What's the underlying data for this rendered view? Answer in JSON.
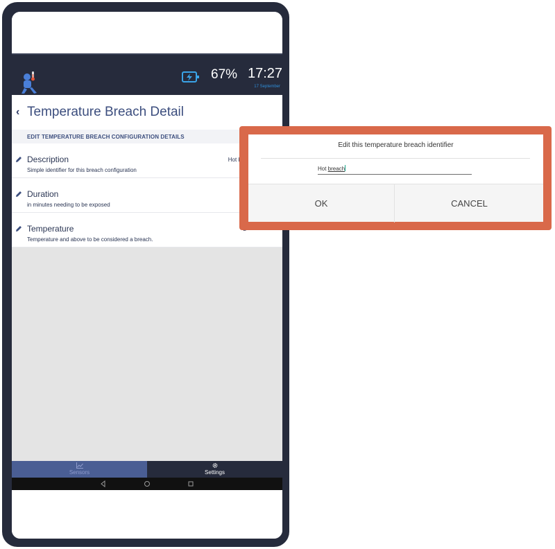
{
  "status_bar": {
    "battery_percent": "67%",
    "time": "17:27",
    "date": "17 September"
  },
  "page": {
    "back_icon": "‹",
    "title": "Temperature Breach Detail",
    "section_header": "EDIT TEMPERATURE BREACH CONFIGURATION DETAILS"
  },
  "rows": [
    {
      "label": "Description",
      "description": "Simple identifier for this breach configuration",
      "value": "Hot bre"
    },
    {
      "label": "Duration",
      "description": "in minutes needing to be exposed",
      "value": ""
    },
    {
      "label": "Temperature",
      "description": "Temperature and above to be considered a breach.",
      "value": "2"
    }
  ],
  "tabs": {
    "sensors": "Sensors",
    "settings": "Settings",
    "active": "settings"
  },
  "dialog": {
    "title": "Edit this temperature breach identifier",
    "input_prefix": "Hot ",
    "input_typed": "breach",
    "ok_label": "OK",
    "cancel_label": "CANCEL"
  },
  "colors": {
    "header": "#262b3c",
    "accent": "#3c4e7e",
    "highlight_border": "#d9694a",
    "sensors_tab": "#4a5e94"
  },
  "icons": [
    "app-logo-icon",
    "battery-charging-icon",
    "back-chevron-icon",
    "edit-pencil-icon",
    "chart-icon",
    "gear-icon",
    "nav-back-icon",
    "nav-home-icon",
    "nav-recents-icon"
  ]
}
